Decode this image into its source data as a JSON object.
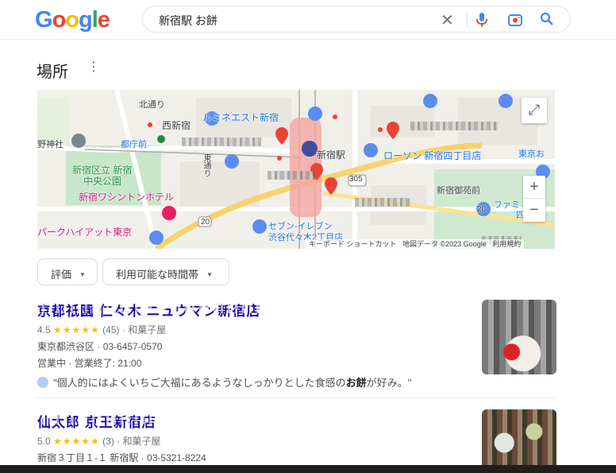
{
  "header": {
    "logo_letters": [
      "G",
      "o",
      "o",
      "g",
      "l",
      "e"
    ],
    "query": "新宿駅 お餅",
    "clear_icon": "close-icon",
    "mic_icon": "mic-icon",
    "lens_icon": "camera-lens-icon",
    "search_icon": "search-icon"
  },
  "section": {
    "title": "場所",
    "more_icon": "more-vert-icon"
  },
  "map": {
    "labels": {
      "kitadori": "北通り",
      "nishishinjuku": "西新宿",
      "lumine": "ルミネエスト新宿",
      "nojinja": "野神社",
      "tochomae": "都庁前",
      "shinjuku_station": "新宿駅",
      "lawson": "ローソン 新宿四丁目店",
      "tokyo_osu": "東京お",
      "park": "新宿区立 新宿",
      "park2": "中央公園",
      "washington": "新宿ワシントンホテル",
      "route305": "305",
      "gyoenmae": "新宿御苑前",
      "famima": "ファミ",
      "famima2": "四丁",
      "park_hyatt": "パークハイアット東京",
      "seven": "セブン-イレブン",
      "seven2": "渋谷代々木2丁目店",
      "route20a": "20",
      "route20b": "20",
      "keyboard": "キーボード ショートカット",
      "mapdata": "地図データ ©2023 Google",
      "terms": "利用規約",
      "higashi": "東通り"
    },
    "zoom_in": "+",
    "zoom_out": "−",
    "expand_icon": "expand-icon"
  },
  "filters": [
    {
      "label": "評価"
    },
    {
      "label": "利用可能な時間帯"
    }
  ],
  "places": [
    {
      "name": "京都祇園 仁々木 ニュウマン新宿店",
      "rating": "4.5",
      "stars": "★★★★★",
      "reviews": "(45)",
      "category": "和菓子屋",
      "address": "東京都渋谷区",
      "phone": "03-6457-0570",
      "hours": "営業中 · 営業終了: 21:00",
      "review_quote_pre": "\"個人的にはよくいちご大福にあるようなしっかりとした食感の",
      "review_quote_bold": "お餅",
      "review_quote_post": "が好み。\""
    },
    {
      "name": "仙太郎 京王新宿店",
      "rating": "5.0",
      "stars": "★★★★★",
      "reviews": "(3)",
      "category": "和菓子屋",
      "address": "新宿３丁目１-１ 新宿駅",
      "phone": "03-5321-8224"
    }
  ],
  "colors": {
    "link": "#1a0dab",
    "star": "#fbbc04",
    "pin": "#ea4335",
    "station": "#3c4da3"
  }
}
